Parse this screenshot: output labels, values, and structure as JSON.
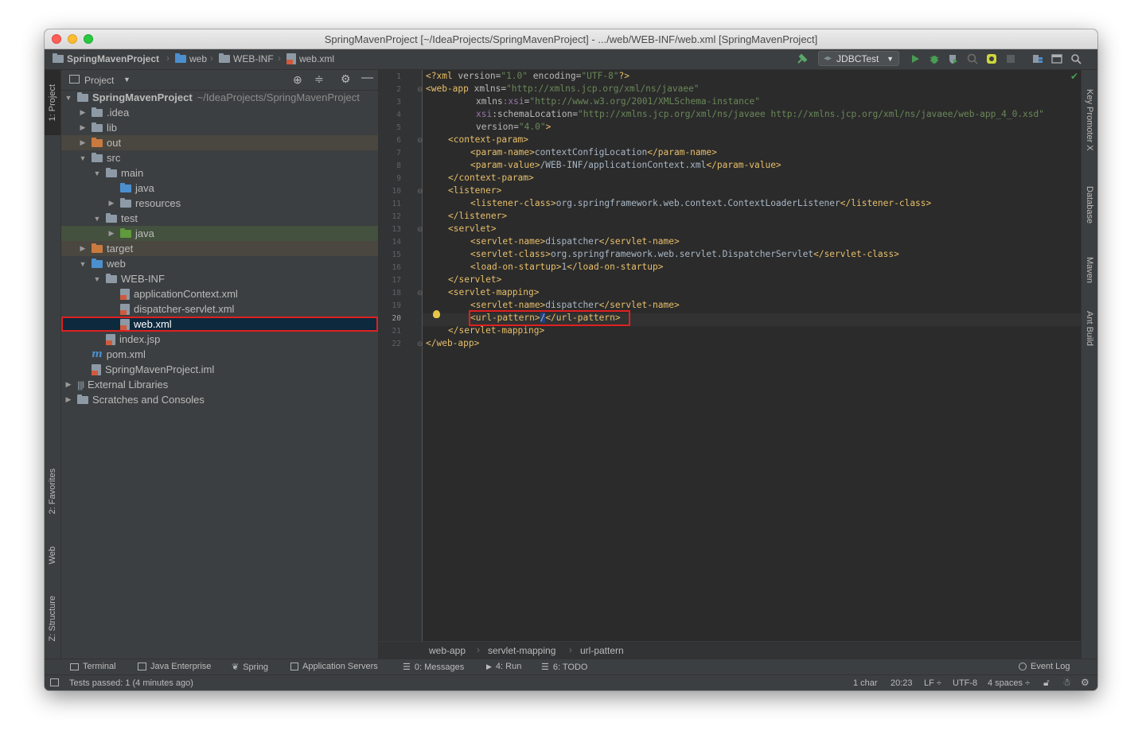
{
  "window": {
    "title": "SpringMavenProject [~/IdeaProjects/SpringMavenProject] - .../web/WEB-INF/web.xml [SpringMavenProject]"
  },
  "navbar": {
    "crumbs": [
      "SpringMavenProject",
      "web",
      "WEB-INF",
      "web.xml"
    ],
    "run_config": "JDBCTest"
  },
  "left_strip": {
    "tabs": [
      "1: Project",
      "2: Favorites",
      "Web",
      "Z: Structure"
    ]
  },
  "right_strip": {
    "tabs": [
      "Key Promoter X",
      "Database",
      "Maven",
      "Ant Build"
    ]
  },
  "project_panel": {
    "title": "Project",
    "tree": [
      {
        "label": "SpringMavenProject",
        "path": "~/IdeaProjects/SpringMavenProject"
      },
      {
        "label": ".idea"
      },
      {
        "label": "lib"
      },
      {
        "label": "out"
      },
      {
        "label": "src"
      },
      {
        "label": "main"
      },
      {
        "label": "java"
      },
      {
        "label": "resources"
      },
      {
        "label": "test"
      },
      {
        "label": "java"
      },
      {
        "label": "target"
      },
      {
        "label": "web"
      },
      {
        "label": "WEB-INF"
      },
      {
        "label": "applicationContext.xml"
      },
      {
        "label": "dispatcher-servlet.xml"
      },
      {
        "label": "web.xml"
      },
      {
        "label": "index.jsp"
      },
      {
        "label": "pom.xml"
      },
      {
        "label": "SpringMavenProject.iml"
      },
      {
        "label": "External Libraries"
      },
      {
        "label": "Scratches and Consoles"
      }
    ]
  },
  "editor": {
    "line_numbers": [
      "1",
      "2",
      "3",
      "4",
      "5",
      "6",
      "7",
      "8",
      "9",
      "10",
      "11",
      "12",
      "13",
      "14",
      "15",
      "16",
      "17",
      "18",
      "19",
      "20",
      "21",
      "22"
    ],
    "current_line": "20",
    "breadcrumb": [
      "web-app",
      "servlet-mapping",
      "url-pattern"
    ],
    "code": {
      "l1": {
        "a": "<?xml ",
        "b": "version",
        "c": "=",
        "d": "\"1.0\"",
        "e": " encoding",
        "f": "=",
        "g": "\"UTF-8\"",
        "h": "?>"
      },
      "l2": {
        "a": "<web-app ",
        "b": "xmlns",
        "c": "=",
        "d": "\"http://xmlns.jcp.org/xml/ns/javaee\""
      },
      "l3": {
        "a": "xmlns",
        "b": ":xsi",
        "c": "=",
        "d": "\"http://www.w3.org/2001/XMLSchema-instance\""
      },
      "l4": {
        "a": "xsi",
        "b": ":schemaLocation",
        "c": "=",
        "d": "\"http://xmlns.jcp.org/xml/ns/javaee http://xmlns.jcp.org/xml/ns/javaee/web-app_4_0.xsd\""
      },
      "l5": {
        "a": "version",
        "b": "=",
        "c": "\"4.0\"",
        "d": ">"
      },
      "l6": "<context-param>",
      "l7": {
        "a": "<param-name>",
        "b": "contextConfigLocation",
        "c": "</param-name>"
      },
      "l8": {
        "a": "<param-value>",
        "b": "/WEB-INF/applicationContext.xml",
        "c": "</param-value>"
      },
      "l9": "</context-param>",
      "l10": "<listener>",
      "l11": {
        "a": "<listener-class>",
        "b": "org.springframework.web.context.ContextLoaderListener",
        "c": "</listener-class>"
      },
      "l12": "</listener>",
      "l13": "<servlet>",
      "l14": {
        "a": "<servlet-name>",
        "b": "dispatcher",
        "c": "</servlet-name>"
      },
      "l15": {
        "a": "<servlet-class>",
        "b": "org.springframework.web.servlet.DispatcherServlet",
        "c": "</servlet-class>"
      },
      "l16": {
        "a": "<load-on-startup>",
        "b": "1",
        "c": "</load-on-startup>"
      },
      "l17": "</servlet>",
      "l18": "<servlet-mapping>",
      "l19": {
        "a": "<servlet-name>",
        "b": "dispatcher",
        "c": "</servlet-name>"
      },
      "l20": {
        "a": "<url-pattern>",
        "b": "/",
        "c": "</url-pattern>"
      },
      "l21": "</servlet-mapping>",
      "l22": "</web-app>"
    }
  },
  "tool_windows": {
    "terminal": "Terminal",
    "java_enterprise": "Java Enterprise",
    "spring": "Spring",
    "app_servers": "Application Servers",
    "messages": "0: Messages",
    "run": "4: Run",
    "todo": "6: TODO",
    "event_log": "Event Log"
  },
  "status": {
    "message": "Tests passed: 1 (4 minutes ago)",
    "selection": "1 char",
    "position": "20:23",
    "line_sep": "LF ÷",
    "encoding": "UTF-8",
    "indent": "4 spaces ÷"
  },
  "colors": {
    "tag": "#e8bf6a",
    "string": "#6a8759",
    "namespace": "#9876aa",
    "highlight_box": "#e02020",
    "selection": "#0d293e"
  }
}
